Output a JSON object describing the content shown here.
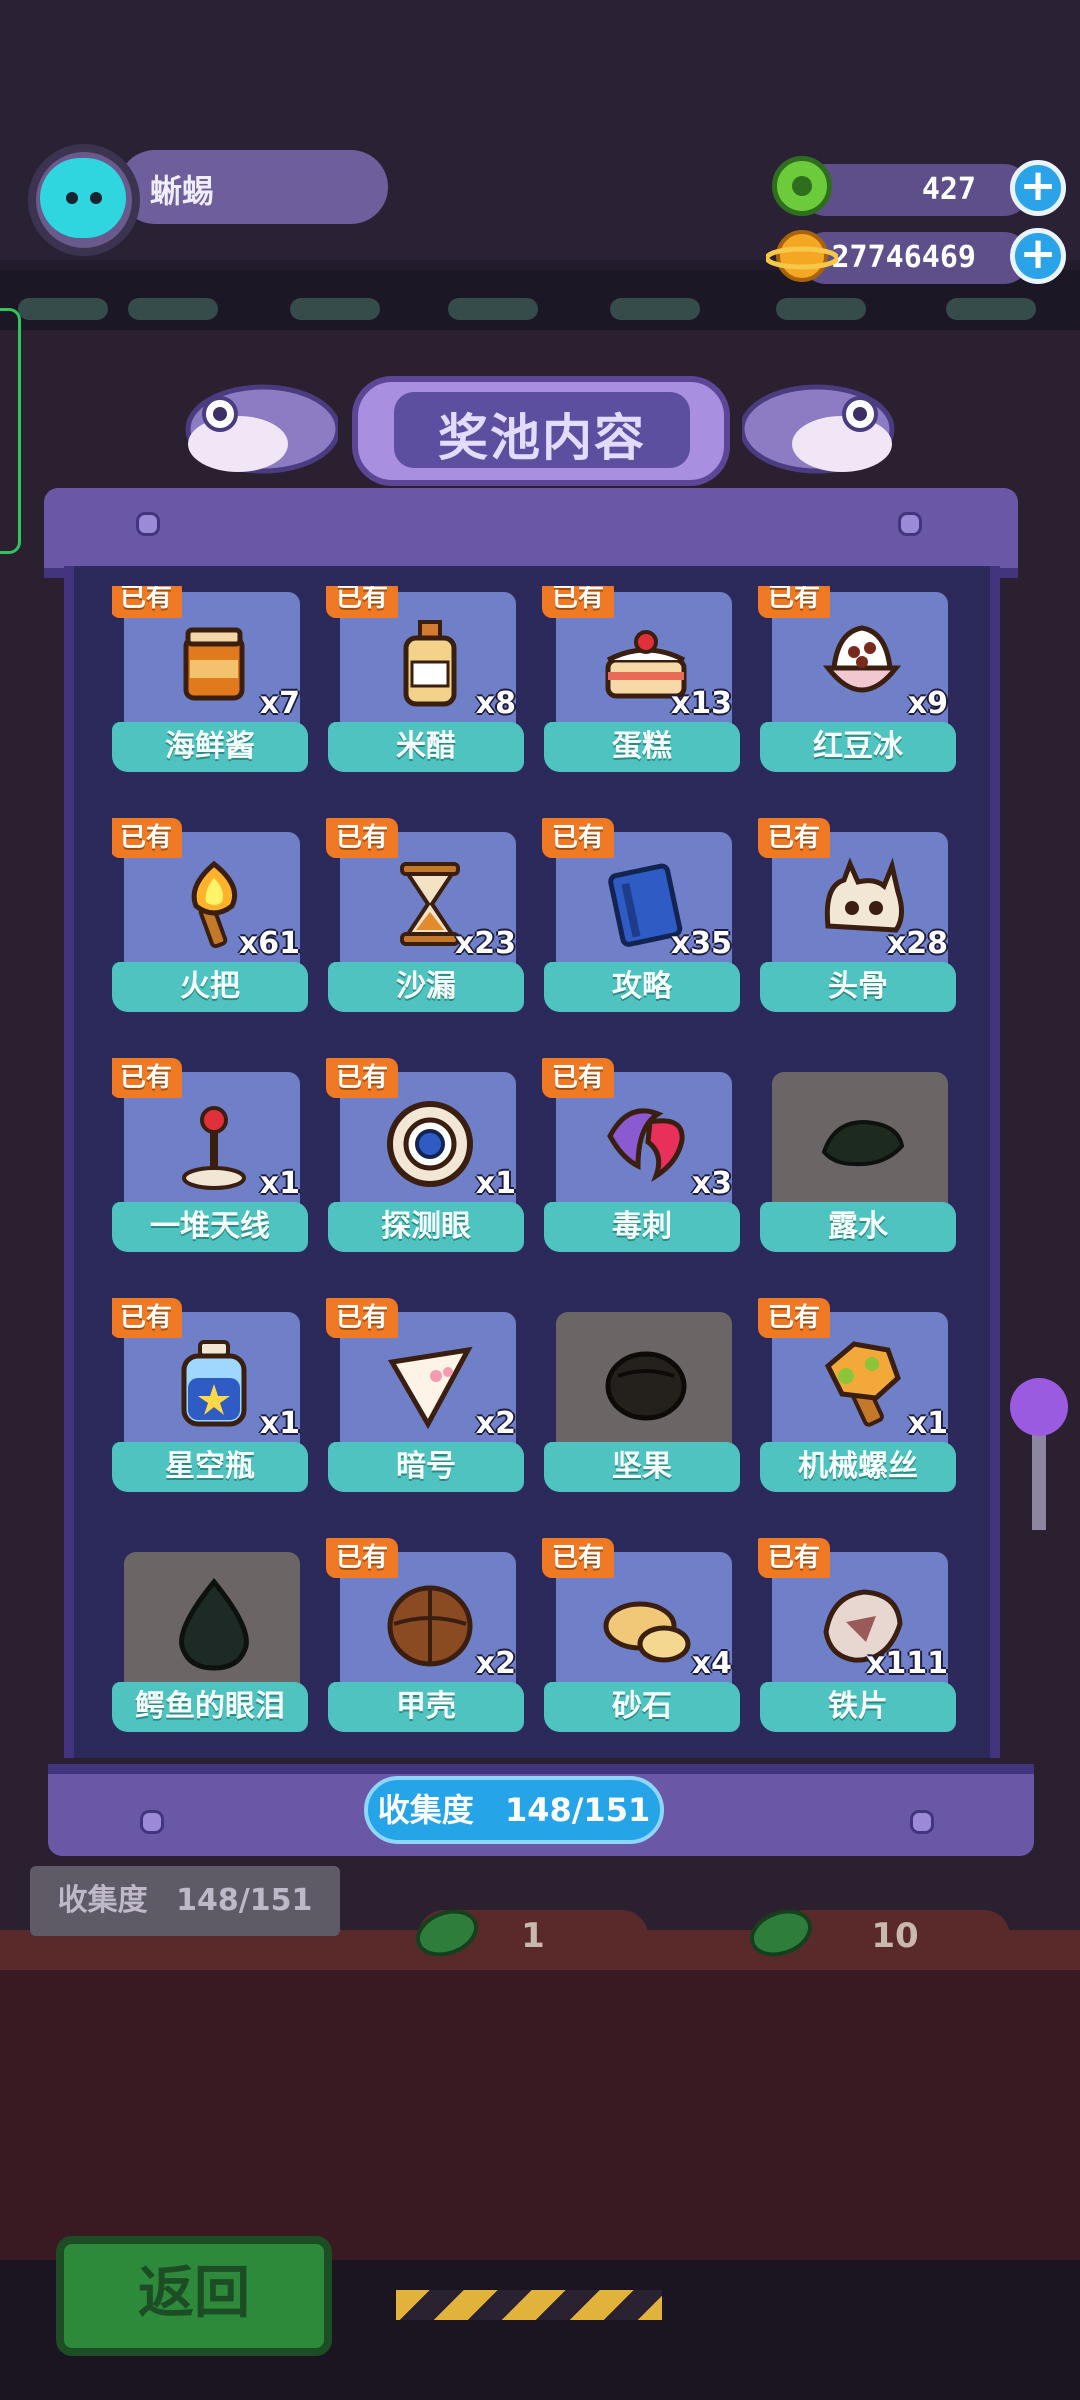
{
  "player": {
    "name": "蜥蜴"
  },
  "currency": {
    "gems": "427",
    "coins": "27746469",
    "add_symbol": "+"
  },
  "panel": {
    "title": "奖池内容",
    "collection_label": "收集度",
    "collection_value": "148/151"
  },
  "owned_badge": "已有",
  "items": [
    {
      "name": "海鲜酱",
      "count": "x7",
      "owned": true,
      "icon": "jar-icon"
    },
    {
      "name": "米醋",
      "count": "x8",
      "owned": true,
      "icon": "vinegar-bottle-icon"
    },
    {
      "name": "蛋糕",
      "count": "x13",
      "owned": true,
      "icon": "cake-icon"
    },
    {
      "name": "红豆冰",
      "count": "x9",
      "owned": true,
      "icon": "red-bean-ice-icon"
    },
    {
      "name": "火把",
      "count": "x61",
      "owned": true,
      "icon": "torch-icon"
    },
    {
      "name": "沙漏",
      "count": "x23",
      "owned": true,
      "icon": "hourglass-icon"
    },
    {
      "name": "攻略",
      "count": "x35",
      "owned": true,
      "icon": "guide-book-icon"
    },
    {
      "name": "头骨",
      "count": "x28",
      "owned": true,
      "icon": "skull-icon"
    },
    {
      "name": "一堆天线",
      "count": "x1",
      "owned": true,
      "icon": "antenna-icon"
    },
    {
      "name": "探测眼",
      "count": "x1",
      "owned": true,
      "icon": "detector-eye-icon"
    },
    {
      "name": "毒刺",
      "count": "x3",
      "owned": true,
      "icon": "venom-sting-icon"
    },
    {
      "name": "露水",
      "count": "",
      "owned": false,
      "icon": "dew-icon"
    },
    {
      "name": "星空瓶",
      "count": "x1",
      "owned": true,
      "icon": "star-bottle-icon"
    },
    {
      "name": "暗号",
      "count": "x2",
      "owned": true,
      "icon": "secret-note-icon"
    },
    {
      "name": "坚果",
      "count": "",
      "owned": false,
      "icon": "nut-icon"
    },
    {
      "name": "机械螺丝",
      "count": "x1",
      "owned": true,
      "icon": "mech-screw-icon"
    },
    {
      "name": "鳄鱼的眼泪",
      "count": "",
      "owned": false,
      "icon": "crocodile-tear-icon"
    },
    {
      "name": "甲壳",
      "count": "x2",
      "owned": true,
      "icon": "shell-icon"
    },
    {
      "name": "砂石",
      "count": "x4",
      "owned": true,
      "icon": "gravel-icon"
    },
    {
      "name": "铁片",
      "count": "x111",
      "owned": true,
      "icon": "iron-piece-icon"
    }
  ],
  "background": {
    "collection_label": "收集度",
    "collection_value": "148/151",
    "slot1": "1",
    "slot10": "10"
  },
  "back_button": "返回",
  "colors": {
    "owned_badge": "#f07a24",
    "label_teal": "#4ec3bf",
    "cell_owned": "#6f80c9",
    "cell_locked": "#6b6565",
    "panel": "#6a58a6",
    "accent_blue": "#25a4e8"
  }
}
